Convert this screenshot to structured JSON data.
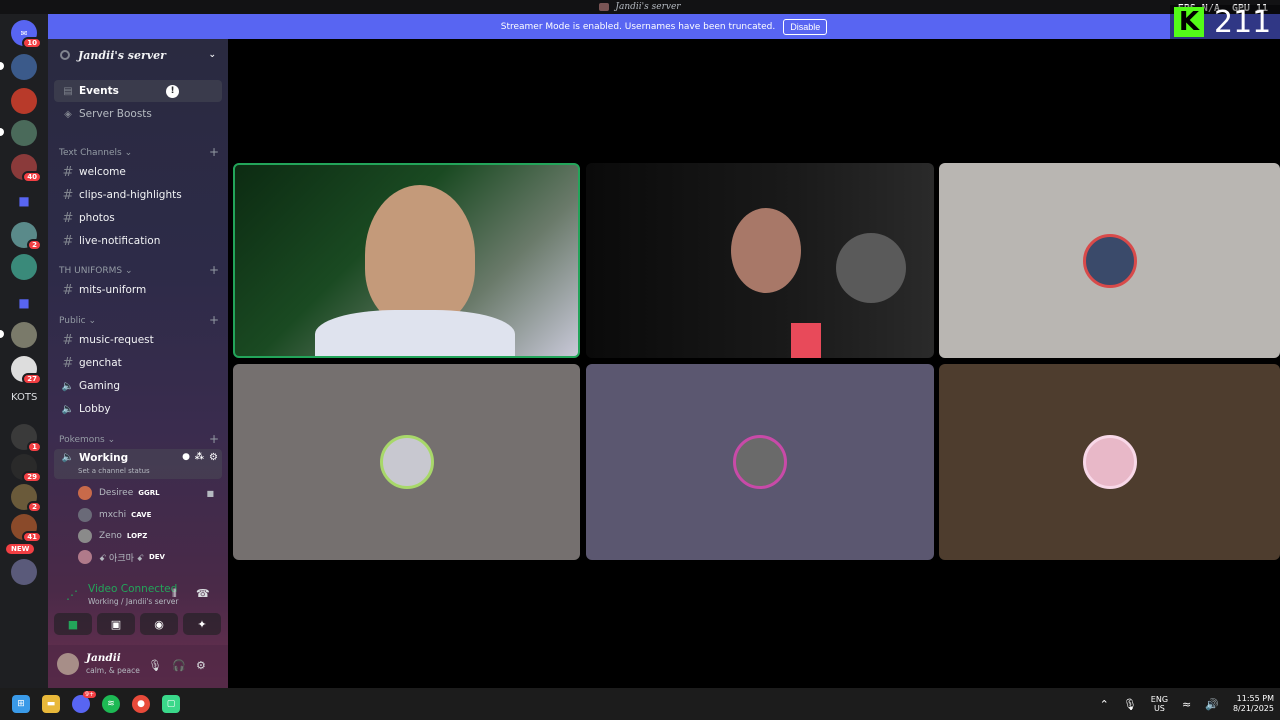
{
  "titlebar": {
    "title": "Jandii's server"
  },
  "banner": {
    "message": "Streamer Mode is enabled. Usernames have been truncated.",
    "button": "Disable"
  },
  "overlay": {
    "fps_label": "FPS",
    "fps_value": "N/A",
    "gpu_label": "GPU",
    "gpu_value": "11",
    "viewer_count": "211"
  },
  "rail": {
    "badges": [
      "10",
      "40",
      "2",
      "27",
      "1",
      "29",
      "2",
      "41"
    ],
    "kots_label": "KOTS",
    "new_label": "NEW"
  },
  "sidebar": {
    "server_name": "Jandii's server",
    "events": "Events",
    "boosts": "Server Boosts",
    "categories": {
      "text": "Text Channels",
      "uniforms": "TH UNIFORMS",
      "public": "Public",
      "pokemons": "Pokemons"
    },
    "text_channels": [
      "welcome",
      "clips-and-highlights",
      "photos",
      "live-notification"
    ],
    "uniform_channels": [
      "mits-uniform"
    ],
    "public_channels": [
      "music-request",
      "genchat",
      "Gaming",
      "Lobby"
    ],
    "voice_channel": {
      "name": "Working",
      "status": "Set a channel status"
    },
    "members": [
      {
        "name": "Desiree",
        "tag": "GGRL",
        "color": "#c86a4a"
      },
      {
        "name": "mxchi",
        "tag": "CAVE",
        "color": "#6a6a78"
      },
      {
        "name": "Zeno",
        "tag": "LOPZ",
        "color": "#8a8a8a"
      },
      {
        "name": "ꗃ 아크마 ꗃ",
        "tag": "DEV",
        "color": "#b07a8a"
      }
    ],
    "voice_status": {
      "title": "Video Connected",
      "subtitle": "Working / Jandii's server"
    },
    "user": {
      "name": "Jandii",
      "status": "calm, & peace"
    }
  },
  "taskbar": {
    "lang_top": "ENG",
    "lang_bottom": "US",
    "time": "11:55 PM",
    "date": "8/21/2025",
    "discord_badge": "9+"
  },
  "colors": {
    "accent": "#5865f2",
    "connected": "#23a55a",
    "kick": "#53fc18"
  }
}
